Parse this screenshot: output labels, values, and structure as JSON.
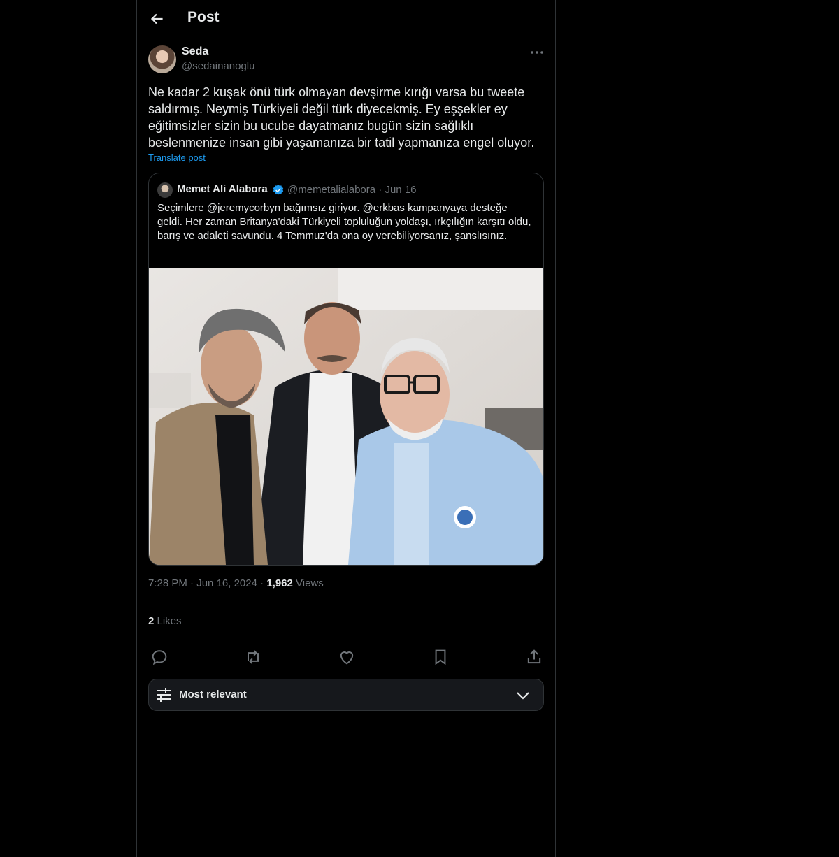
{
  "header": {
    "title": "Post",
    "back_icon": "arrow-left-icon"
  },
  "post": {
    "author_name": "Seda",
    "author_handle": "@sedainanoglu",
    "text": "Ne kadar 2 kuşak önü türk olmayan devşirme kırığı varsa bu tweete saldırmış. Neymiş Türkiyeli değil türk diyecekmiş. Ey eşşekler ey eğitimsizler sizin bu ucube dayatmanız bugün sizin sağlıklı beslenmenize insan gibi yaşamanıza bir tatil yapmanıza engel oluyor.",
    "translate_label": "Translate post",
    "time": "7:28 PM",
    "date": "Jun 16, 2024",
    "views_count": "1,962",
    "views_label": "Views",
    "likes_count": "2",
    "likes_label": "Likes"
  },
  "quote": {
    "author_name": "Memet Ali Alabora",
    "author_handle": "@memetalialabora",
    "date": "Jun 16",
    "text": "Seçimlere @jeremycorbyn bağımsız giriyor. @erkbas kampanyaya desteğe geldi. Her zaman Britanya'daki Türkiyeli topluluğun yoldaşı, ırkçılığın karşıtı oldu, barış ve adaleti savundu. 4 Temmuz'da ona oy verebiliyorsanız, şanslısınız.",
    "verified": true,
    "verified_color": "#1d9bf0"
  },
  "actions": [
    "reply-icon",
    "repost-icon",
    "like-icon",
    "bookmark-icon",
    "share-icon"
  ],
  "sort": {
    "label": "Most relevant"
  },
  "colors": {
    "bg": "#000000",
    "text": "#e7e9ea",
    "muted": "#71767b",
    "link": "#1d9bf0",
    "border": "#2f3336"
  }
}
